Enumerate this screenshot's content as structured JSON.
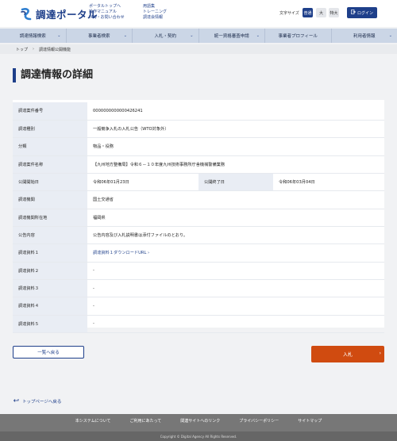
{
  "header": {
    "logo_text": "調達ポータル",
    "links_col1": [
      "ポータルトップへ",
      "操作マニュアル",
      "FAQ・お問い合わせ"
    ],
    "links_col2": [
      "用語集",
      "トレーニング",
      "調達会情報"
    ],
    "font_size_label": "文字サイズ",
    "font_sizes": [
      "普通",
      "大",
      "特大"
    ],
    "login_label": "ログイン"
  },
  "nav": {
    "items": [
      "調達情報検索",
      "事業者検索",
      "入札・契約",
      "統一資格審査申請",
      "事業者プロフィール",
      "利用者情報"
    ]
  },
  "breadcrumb": {
    "home": "トップ",
    "current": "調達情報公開機能"
  },
  "page_title": "調達情報の詳細",
  "detail": {
    "rows": [
      {
        "label": "調達案件番号",
        "value": "0000000000000426241"
      },
      {
        "label": "調達種別",
        "value": "一般競争入札の入札公告（WTO対象外）"
      },
      {
        "label": "分類",
        "value": "物品・役務"
      },
      {
        "label": "調達案件名称",
        "value": "【九州地方整備局】令和６－１０年度九州技術事務所庁舎機械警備業務"
      },
      {
        "label": "公開開始日",
        "value": "令和06年01月23日",
        "label2": "公開終了日",
        "value2": "令和06年03月04日"
      },
      {
        "label": "調達機関",
        "value": "国土交通省"
      },
      {
        "label": "調達機関所在地",
        "value": "福岡県"
      },
      {
        "label": "公告内容",
        "value": "公告内容及び入札説明書は添付ファイルのとおり。"
      },
      {
        "label": "調達資料１",
        "value": "調達資料１ダウンロードURL"
      },
      {
        "label": "調達資料２",
        "value": "-"
      },
      {
        "label": "調達資料３",
        "value": "-"
      },
      {
        "label": "調達資料４",
        "value": "-"
      },
      {
        "label": "調達資料５",
        "value": "-"
      }
    ]
  },
  "buttons": {
    "back": "一覧へ戻る",
    "bid": "入札"
  },
  "top_link": "トップページへ戻る",
  "footer": {
    "links": [
      "本システムについて",
      "ご利用にあたって",
      "関連サイトへのリンク",
      "プライバシーポリシー",
      "サイトマップ"
    ],
    "copyright": "Copyright © Digital Agency All Rights Reserved."
  },
  "colors": {
    "brand": "#1e3f8a",
    "accent": "#d04b10"
  }
}
